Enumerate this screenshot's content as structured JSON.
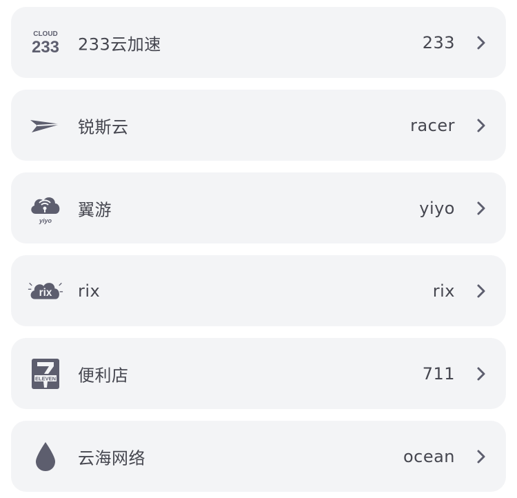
{
  "accent_color": "#5d5e6e",
  "providers": [
    {
      "icon": "cloud-233-logo-icon",
      "name": "233云加速",
      "value": "233",
      "logo_text_top": "CLOUD",
      "logo_text_bottom": "233"
    },
    {
      "icon": "paper-plane-icon",
      "name": "锐斯云",
      "value": "racer"
    },
    {
      "icon": "yiyo-cloud-signal-icon",
      "name": "翼游",
      "value": "yiyo",
      "logo_text": "yiyo"
    },
    {
      "icon": "rix-cloud-logo-icon",
      "name": "rix",
      "value": "rix",
      "logo_text": "rix"
    },
    {
      "icon": "seven-eleven-logo-icon",
      "name": "便利店",
      "value": "711",
      "logo_text": "ELEVEN"
    },
    {
      "icon": "water-drop-icon",
      "name": "云海网络",
      "value": "ocean"
    }
  ]
}
